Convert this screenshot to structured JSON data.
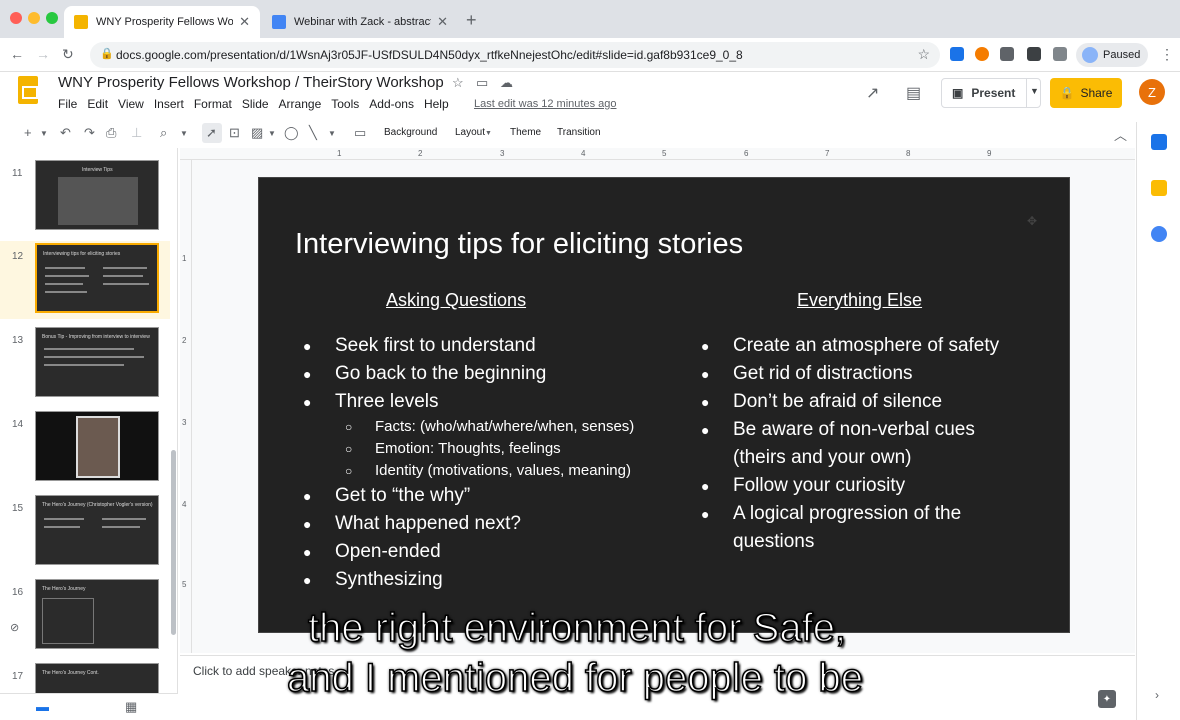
{
  "browser": {
    "tabs": [
      {
        "title": "WNY Prosperity Fellows Workshop",
        "active": true
      },
      {
        "title": "Webinar with Zack - abstract",
        "active": false
      }
    ],
    "url": "docs.google.com/presentation/d/1WsnAj3r05JF-USfDSULD4N50dyx_rtfkeNnejestOhc/edit#slide=id.gaf8b931ce9_0_8",
    "profile_label": "Paused"
  },
  "doc": {
    "title": "WNY Prosperity Fellows Workshop / TheirStory Workshop",
    "menus": [
      "File",
      "Edit",
      "View",
      "Insert",
      "Format",
      "Slide",
      "Arrange",
      "Tools",
      "Add-ons",
      "Help"
    ],
    "last_edit": "Last edit was 12 minutes ago",
    "present_label": "Present",
    "share_label": "Share",
    "user_initial": "Z"
  },
  "toolbar": {
    "background": "Background",
    "layout": "Layout",
    "theme": "Theme",
    "transition": "Transition"
  },
  "ruler": {
    "h_ticks": [
      "1",
      "2",
      "3",
      "4",
      "5",
      "6",
      "7",
      "8",
      "9"
    ],
    "v_ticks": [
      "1",
      "2",
      "3",
      "4",
      "5"
    ]
  },
  "filmstrip": {
    "slides": [
      {
        "num": "11",
        "title": "Interview Tips"
      },
      {
        "num": "12",
        "title": "Interviewing tips for eliciting stories"
      },
      {
        "num": "13",
        "title": "Bonus Tip - Improving from interview to interview"
      },
      {
        "num": "14",
        "title": ""
      },
      {
        "num": "15",
        "title": "The Hero's Journey (Christopher Vogler's version)"
      },
      {
        "num": "16",
        "title": "The Hero's Journey"
      },
      {
        "num": "17",
        "title": "The Hero's Journey Cont."
      }
    ]
  },
  "slide": {
    "title": "Interviewing tips for eliciting stories",
    "left_heading": "Asking Questions",
    "right_heading": "Everything Else",
    "left_items": [
      "Seek first to understand",
      "Go back to the beginning",
      "Three levels"
    ],
    "left_sub_items": [
      "Facts: (who/what/where/when, senses)",
      "Emotion: Thoughts, feelings",
      "Identity (motivations, values, meaning)"
    ],
    "left_items_after": [
      "Get to “the why”",
      "What happened next?",
      "Open-ended",
      "Synthesizing"
    ],
    "right_items": [
      "Create an atmosphere of safety",
      "Get rid of distractions",
      "Don’t be afraid of silence",
      "Be aware of non-verbal cues (theirs and your own)",
      "Follow your curiosity",
      "A logical progression of the questions"
    ]
  },
  "notes": {
    "placeholder": "Click to add speaker notes"
  },
  "captions": [
    "the right environment for Safe,",
    "and I mentioned for people to be"
  ]
}
